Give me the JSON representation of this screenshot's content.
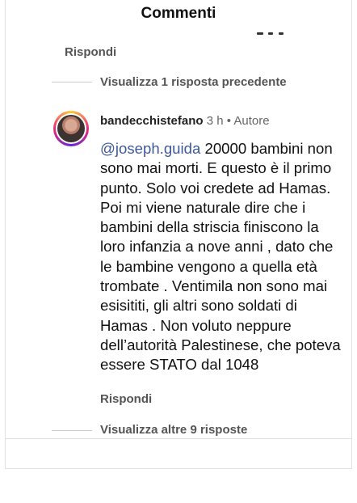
{
  "header": {
    "title": "Commenti"
  },
  "thread": {
    "reply_top": "Rispondi",
    "view_previous": "Visualizza 1 risposta precedente",
    "view_more": "Visualizza altre 9 risposte"
  },
  "comment": {
    "username": "bandecchistefano",
    "time": "3 h",
    "separator": "•",
    "author_badge": "Autore",
    "mention": "@joseph.guida",
    "text": " 20000 bambini non sono mai morti. E questo è il primo punto. Solo voi credete ad Hamas. Poi mi viene naturale dire che i bambini della striscia finiscono la loro infanzia a nove anni , dato che le bambine vengono a quella età trombate . Ventimila non sono mai esisititi, gli altri sono soldati di Hamas . Non voluto neppure dell’autorità Palestinese, che poteva essere STATO dal 1048",
    "reply_label": "Rispondi"
  }
}
